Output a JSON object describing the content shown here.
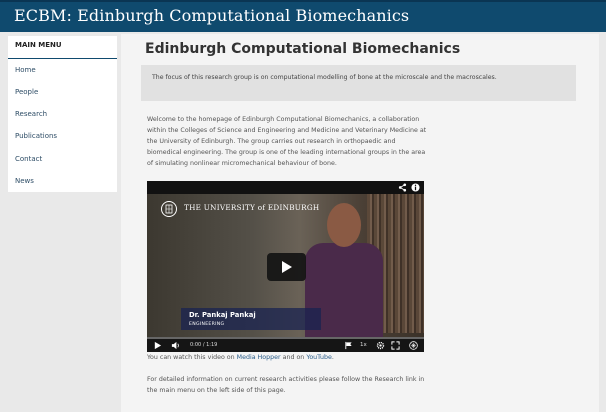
{
  "site": {
    "title": "ECBM: Edinburgh Computational Biomechanics"
  },
  "sidebar": {
    "title": "MAIN MENU",
    "items": [
      {
        "label": "Home"
      },
      {
        "label": "People"
      },
      {
        "label": "Research"
      },
      {
        "label": "Publications"
      },
      {
        "label": "Contact"
      },
      {
        "label": "News"
      }
    ]
  },
  "main": {
    "title": "Edinburgh Computational Biomechanics",
    "intro": "The focus of this research group is on computational modelling of bone at the microscale and the macroscales.",
    "welcome_lines": [
      "Welcome to the homepage of Edinburgh Computational Biomechanics, a collaboration",
      "within the Colleges of Science and Engineering and Medicine and Veterinary Medicine at",
      "the University of Edinburgh. The group carries out research in orthopaedic and",
      "biomedical engineering. The group is one of the leading international groups in the area",
      "of simulating nonlinear micromechanical behaviour of bone."
    ],
    "video": {
      "institution": "THE UNIVERSITY of EDINBURGH",
      "caption_name": "Dr. Pankaj Pankaj",
      "caption_dept": "ENGINEERING",
      "time": "0:00 / 1:19",
      "speed": "1x",
      "progress": 0
    },
    "watch": {
      "prefix": "You can watch this video on ",
      "link1": "Media Hopper",
      "middle": " and on ",
      "link2": "YouTube",
      "suffix": "."
    },
    "detail_lines": [
      "For detailed information on current research activities please follow the Research link in",
      "the main menu on the left side of this page."
    ]
  }
}
